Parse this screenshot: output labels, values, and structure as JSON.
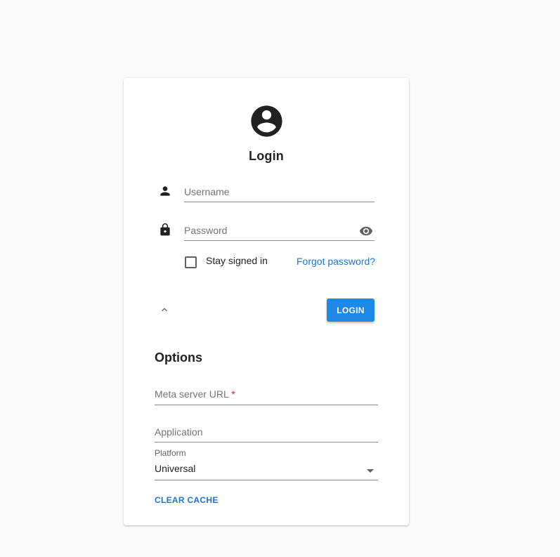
{
  "login": {
    "title": "Login",
    "username_placeholder": "Username",
    "password_placeholder": "Password",
    "stay_signed_in": "Stay signed in",
    "forgot_password": "Forgot password?",
    "login_button": "LOGIN"
  },
  "options": {
    "title": "Options",
    "meta_server_label": "Meta server URL",
    "required_marker": "*",
    "application_placeholder": "Application",
    "platform_label": "Platform",
    "platform_value": "Universal",
    "clear_cache_button": "CLEAR CACHE"
  },
  "icons": {
    "avatar": "account-circle-icon",
    "username": "person-icon",
    "password": "lock-icon",
    "visibility": "eye-icon",
    "collapse": "chevron-up-icon",
    "dropdown": "arrow-drop-down-icon"
  },
  "colors": {
    "primary": "#1e88e5",
    "link": "#1976d2",
    "required": "#c62828",
    "background": "#fafafa",
    "card": "#ffffff"
  }
}
